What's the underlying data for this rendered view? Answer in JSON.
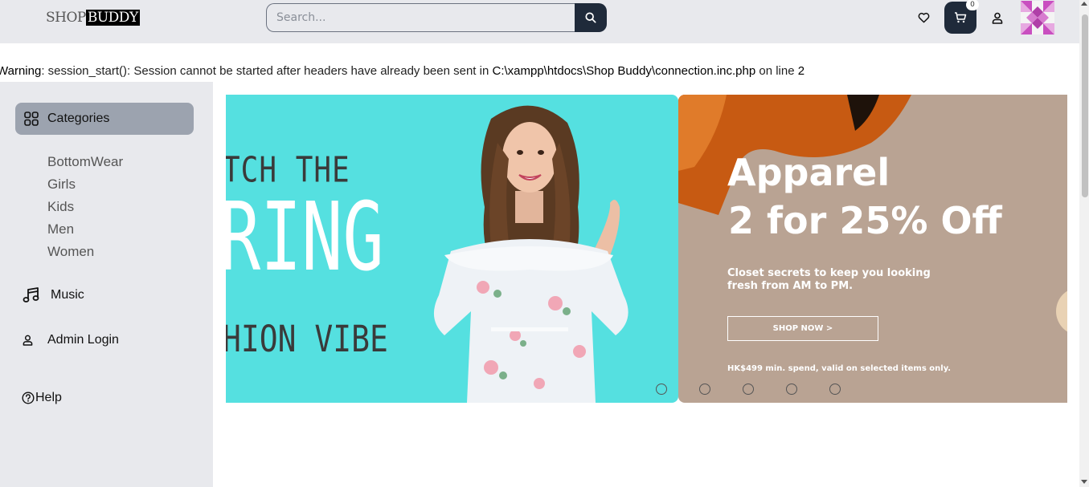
{
  "header": {
    "logo_shop": "SHOP",
    "logo_buddy": "BUDDY",
    "search_placeholder": "Search...",
    "cart_count": "0"
  },
  "warning": {
    "prefix": "Warning",
    "message": ": session_start(): Session cannot be started after headers have already been sent in ",
    "file": "C:\\xampp\\htdocs\\Shop Buddy\\connection.inc.php",
    "on_line": " on line ",
    "line": "2"
  },
  "sidebar": {
    "categories_label": "Categories",
    "subcategories": [
      "BottomWear",
      "Girls",
      "Kids",
      "Men",
      "Women"
    ],
    "music_label": "Music",
    "admin_label": "Admin Login",
    "help_label": "Help"
  },
  "carousel": {
    "slide1": {
      "line1": "TCH THE",
      "line2": "RING",
      "line3": "HION VIBE",
      "bg_color": "#55e0e0"
    },
    "slide2": {
      "title1": "Apparel",
      "title2": "2 for 25% Off",
      "subtitle1": "Closet secrets to keep you looking",
      "subtitle2": "fresh from AM to PM.",
      "button": "SHOP NOW >",
      "fine_print": "HK$499 min. spend, valid on selected items only.",
      "bg_color": "#b9a393"
    },
    "dot_count": 5
  },
  "colors": {
    "header_bg": "#e8e9ed",
    "dark_button": "#1f2a3a",
    "categories_bg": "#9ca3af"
  }
}
